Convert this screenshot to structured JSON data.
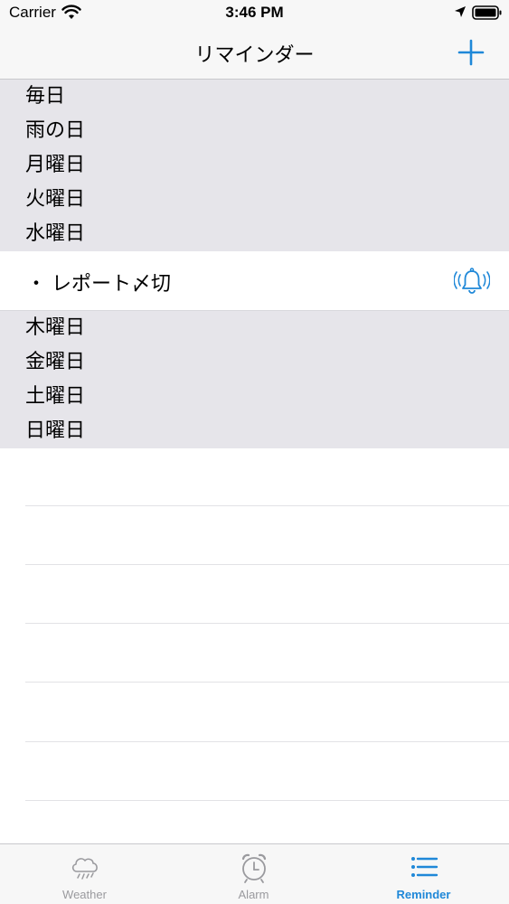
{
  "status_bar": {
    "carrier": "Carrier",
    "time": "3:46 PM",
    "icons": [
      "wifi-icon",
      "location-arrow-icon",
      "battery-icon"
    ]
  },
  "nav": {
    "title": "リマインダー",
    "add_icon": "plus-icon",
    "accent_color": "#1f88d8"
  },
  "list": {
    "group_top": [
      "毎日",
      "雨の日",
      "月曜日",
      "火曜日",
      "水曜日"
    ],
    "task": {
      "bullet": "・",
      "label": "レポート〆切",
      "icon": "bell-ringing-icon"
    },
    "group_bottom": [
      "木曜日",
      "金曜日",
      "土曜日",
      "日曜日"
    ]
  },
  "tab_bar": {
    "tabs": [
      {
        "label": "Weather",
        "icon": "rain-cloud-icon",
        "active": false
      },
      {
        "label": "Alarm",
        "icon": "alarm-clock-icon",
        "active": false
      },
      {
        "label": "Reminder",
        "icon": "list-icon",
        "active": true
      }
    ]
  },
  "colors": {
    "group_background": "#e6e5ea",
    "bar_background": "#f7f7f7",
    "inactive_tab": "#9a9a9e"
  }
}
